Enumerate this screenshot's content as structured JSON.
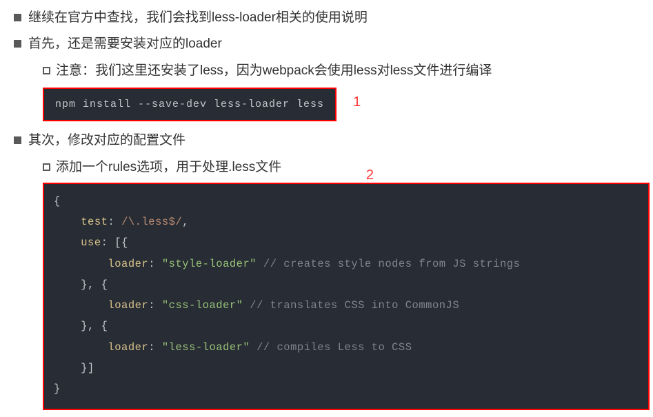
{
  "bullets": {
    "b1": "继续在官方中查找，我们会找到less-loader相关的使用说明",
    "b2": "首先，还是需要安装对应的loader",
    "b2_sub": "注意：我们这里还安装了less，因为webpack会使用less对less文件进行编译",
    "b3": "其次，修改对应的配置文件",
    "b3_sub": "添加一个rules选项，用于处理.less文件"
  },
  "code1": {
    "command": "npm install --save-dev less-loader less",
    "label": "1"
  },
  "code2": {
    "label": "2",
    "tokens": {
      "brace_open": "{",
      "brace_close": "}",
      "test_key": "test",
      "colon": ":",
      "regex_val": "/\\.less$/",
      "comma": ",",
      "use_key": "use",
      "arr_open": "[{",
      "loader_key": "loader",
      "str_style": "\"style-loader\"",
      "comment_style": "// creates style nodes from JS strings",
      "mid_sep": "}, {",
      "str_css": "\"css-loader\"",
      "comment_css": "// translates CSS into CommonJS",
      "str_less": "\"less-loader\"",
      "comment_less": "// compiles Less to CSS",
      "arr_close": "}]"
    }
  }
}
